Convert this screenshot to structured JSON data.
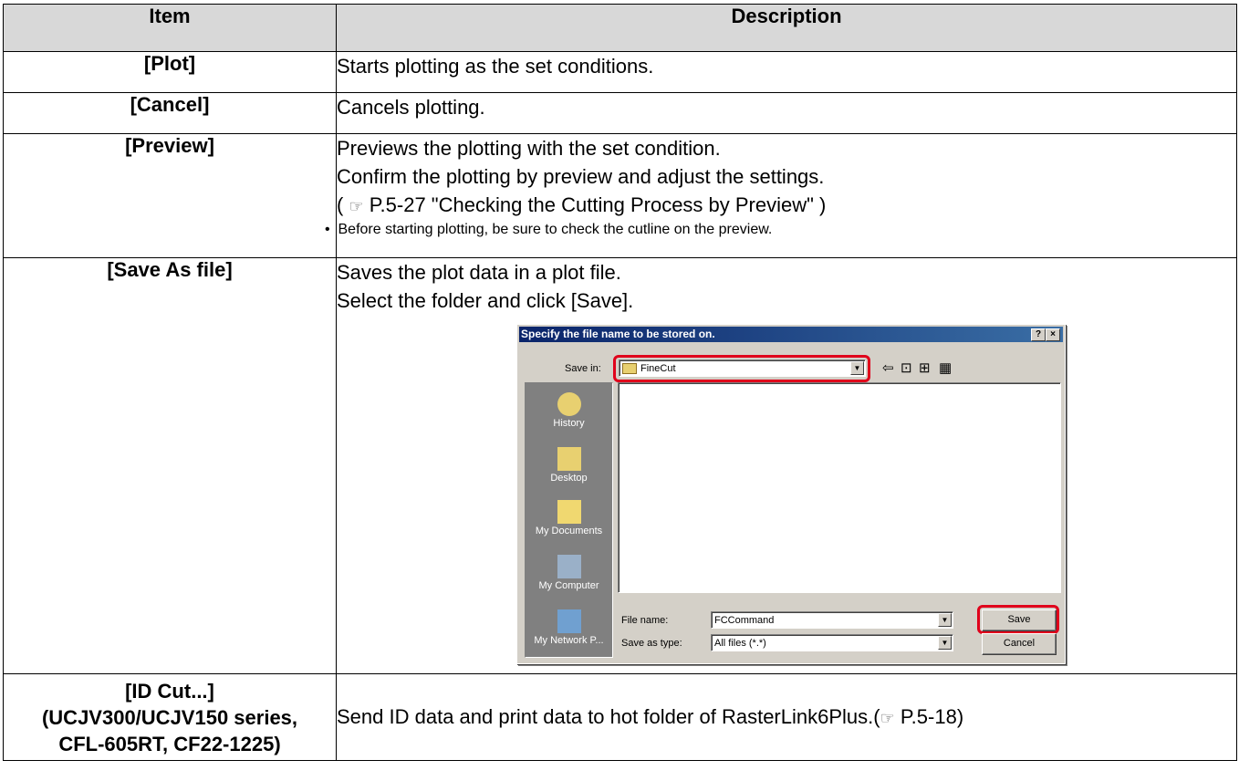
{
  "header": {
    "item": "Item",
    "description": "Description"
  },
  "rows": [
    {
      "item": "[Plot]",
      "desc": [
        "Starts plotting as the set conditions."
      ]
    },
    {
      "item": "[Cancel]",
      "desc": [
        "Cancels plotting."
      ]
    },
    {
      "item": "[Preview]",
      "desc": [
        "Previews the plotting with the set condition.",
        "Confirm the plotting by preview and adjust the settings."
      ],
      "ref_prefix": "( ",
      "ref_icon": "☞",
      "ref_text": " P.5-27 \"Checking the Cutting Process by Preview\" )",
      "note": "Before starting plotting, be sure to check the cutline on the preview."
    },
    {
      "item": "[Save As file]",
      "desc": [
        "Saves the plot data in a plot file.",
        "Select the folder and click [Save]."
      ]
    },
    {
      "item_lines": [
        "[ID Cut...]",
        "(UCJV300/UCJV150 series,",
        "CFL-605RT, CF22-1225)"
      ],
      "desc_text": "Send ID data and print data to hot folder of RasterLink6Plus.(",
      "ref_icon": "☞",
      "desc_ref": " P.5-18)"
    }
  ],
  "dialog": {
    "title": "Specify the file name to be stored on.",
    "help": "?",
    "close": "×",
    "save_in_label": "Save in:",
    "save_in_value": "FineCut",
    "places": [
      "History",
      "Desktop",
      "My Documents",
      "My Computer",
      "My Network P..."
    ],
    "file_name_label": "File name:",
    "file_name_value": "FCCommand",
    "save_type_label": "Save as type:",
    "save_type_value": "All files (*.*)",
    "save_button": "Save",
    "cancel_button": "Cancel",
    "highlight_color": "#e0001b"
  }
}
